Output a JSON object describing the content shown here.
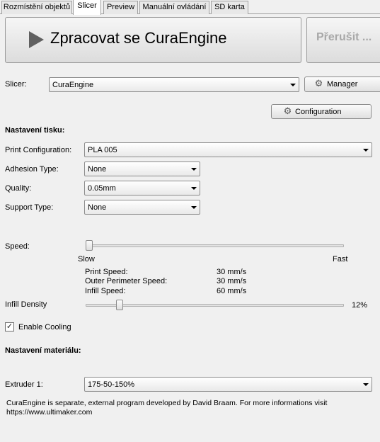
{
  "tabs": [
    {
      "label": "Rozmístění objektů",
      "active": false
    },
    {
      "label": "Slicer",
      "active": true
    },
    {
      "label": "Preview",
      "active": false
    },
    {
      "label": "Manuální ovládání",
      "active": false
    },
    {
      "label": "SD karta",
      "active": false
    }
  ],
  "actions": {
    "process_label": "Zpracovat se CuraEngine",
    "stop_label": "Přerušit ..."
  },
  "slicer": {
    "label": "Slicer:",
    "value": "CuraEngine",
    "manager_label": "Manager",
    "configuration_label": "Configuration"
  },
  "print_settings": {
    "heading": "Nastavení tisku:",
    "print_configuration": {
      "label": "Print Configuration:",
      "value": "PLA 005"
    },
    "adhesion_type": {
      "label": "Adhesion Type:",
      "value": "None"
    },
    "quality": {
      "label": "Quality:",
      "value": "0.05mm"
    },
    "support_type": {
      "label": "Support Type:",
      "value": "None"
    }
  },
  "speed": {
    "label": "Speed:",
    "slow_label": "Slow",
    "fast_label": "Fast",
    "position": 0.0,
    "print_speed_label": "Print Speed:",
    "print_speed_value": "30 mm/s",
    "outer_perimeter_label": "Outer Perimeter Speed:",
    "outer_perimeter_value": "30 mm/s",
    "infill_speed_label": "Infill Speed:",
    "infill_speed_value": "60 mm/s"
  },
  "infill": {
    "label": "Infill Density",
    "value_text": "12%",
    "value": 12
  },
  "cooling": {
    "label": "Enable Cooling",
    "checked": true
  },
  "material": {
    "heading": "Nastavení materiálu:",
    "extruder_label": "Extruder 1:",
    "extruder_value": "175-50-150%"
  },
  "footer": {
    "line1": "CuraEngine is separate, external program developed by David Braam. For more informations visit",
    "line2": "https://www.ultimaker.com"
  },
  "icons": {
    "play": "play-icon",
    "gear": "gears-icon",
    "dropdown": "chevron-down-icon",
    "check": "checkmark-icon"
  },
  "colors": {
    "panel_bg": "#f0f0f0",
    "disabled_text": "#a8a8a8",
    "play_icon": "#606060"
  }
}
